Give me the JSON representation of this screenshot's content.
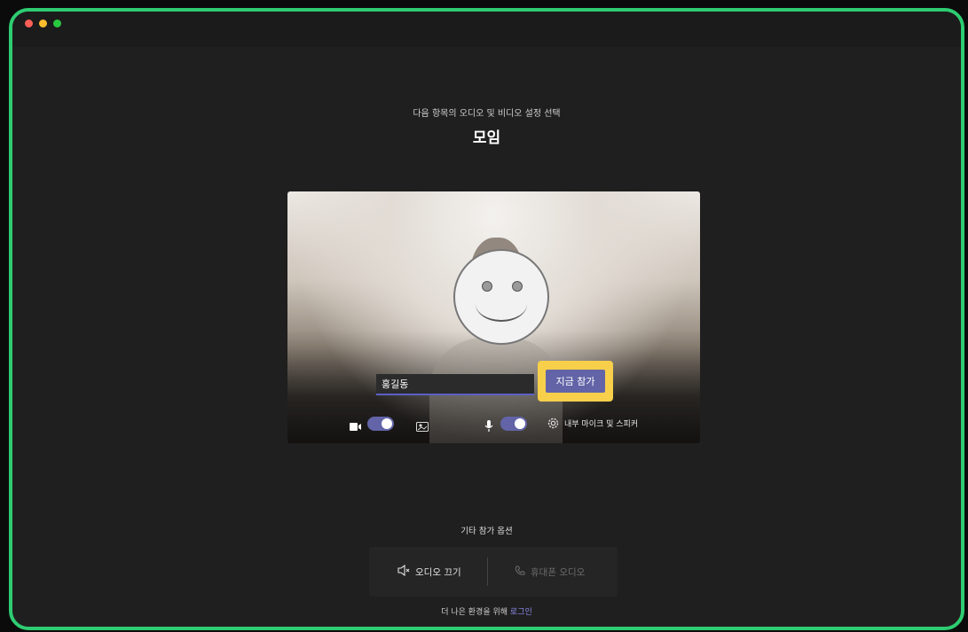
{
  "window": {
    "traffic_lights": [
      "close",
      "minimize",
      "maximize"
    ]
  },
  "header": {
    "subtitle": "다음 항목의 오디오 및 비디오 설정 선택",
    "title": "모임"
  },
  "preview": {
    "name_input_value": "홍길동",
    "join_button_label": "지금 참가",
    "controls": {
      "camera_toggle_on": true,
      "mic_toggle_on": true,
      "device_label": "내부 마이크 및 스피커"
    }
  },
  "other_options": {
    "title": "기타 참가 옵션",
    "audio_off_label": "오디오 끄기",
    "phone_audio_label": "휴대폰 오디오"
  },
  "footer": {
    "signin_prefix": "더 나은 환경을 위해",
    "signin_link": "로그인"
  },
  "colors": {
    "accent": "#6264a7",
    "highlight": "#f7cf4b",
    "frame_border": "#2ecc71",
    "background": "#201f1f"
  }
}
